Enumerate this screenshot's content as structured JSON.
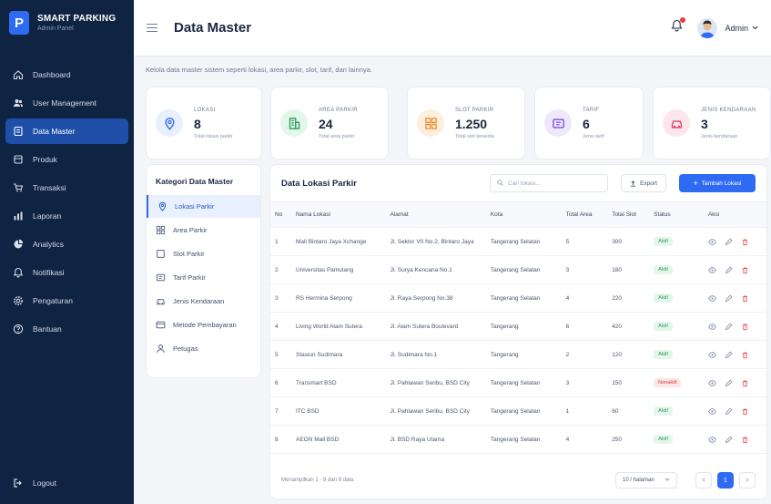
{
  "brand": {
    "logo_letter": "P",
    "title": "SMART PARKING",
    "subtitle": "Admin Panel"
  },
  "sidebar": {
    "items": [
      {
        "label": "Dashboard",
        "icon": "home-icon"
      },
      {
        "label": "User Management",
        "icon": "users-icon"
      },
      {
        "label": "Data Master",
        "icon": "database-icon",
        "active": true
      },
      {
        "label": "Produk",
        "icon": "box-icon"
      },
      {
        "label": "Transaksi",
        "icon": "cart-icon"
      },
      {
        "label": "Laporan",
        "icon": "bar-chart-icon"
      },
      {
        "label": "Analytics",
        "icon": "pie-chart-icon"
      },
      {
        "label": "Notifikasi",
        "icon": "bell-icon"
      },
      {
        "label": "Pengaturan",
        "icon": "gear-icon"
      },
      {
        "label": "Bantuan",
        "icon": "help-icon"
      }
    ],
    "logout_label": "Logout"
  },
  "header": {
    "title": "Data Master",
    "user_name": "Admin"
  },
  "description": "Kelola data master sistem seperti lokasi, area parkir, slot, tarif, dan lainnya.",
  "stats": [
    {
      "label": "LOKASI",
      "value": "8",
      "sub": "Total lokasi parkir",
      "color": "#2f6bf2",
      "bg": "#e8f0fe",
      "icon": "location-icon"
    },
    {
      "label": "AREA PARKIR",
      "value": "24",
      "sub": "Total area parkir",
      "color": "#2c9c5a",
      "bg": "#e3f6ea",
      "icon": "building-icon"
    },
    {
      "label": "SLOT PARKIR",
      "value": "1.250",
      "sub": "Total slot tersedia",
      "color": "#f08a24",
      "bg": "#fdeedd",
      "icon": "grid-icon"
    },
    {
      "label": "TARIF",
      "value": "6",
      "sub": "Jenis tarif",
      "color": "#7a4fe0",
      "bg": "#efe8fc",
      "icon": "ticket-icon"
    },
    {
      "label": "JENIS KENDARAAN",
      "value": "3",
      "sub": "Jenis kendaraan",
      "color": "#e2416b",
      "bg": "#fde7ec",
      "icon": "car-icon"
    }
  ],
  "categories": {
    "title": "Kategori Data Master",
    "items": [
      {
        "label": "Lokasi Parkir",
        "icon": "location-icon",
        "active": true
      },
      {
        "label": "Area Parkir",
        "icon": "grid-icon"
      },
      {
        "label": "Slot Parkir",
        "icon": "square-icon"
      },
      {
        "label": "Tarif Parkir",
        "icon": "ticket-icon"
      },
      {
        "label": "Jenis Kendaraan",
        "icon": "car-icon"
      },
      {
        "label": "Metode Pembayaran",
        "icon": "credit-card-icon"
      },
      {
        "label": "Petugas",
        "icon": "user-icon"
      }
    ]
  },
  "table": {
    "title": "Data Lokasi Parkir",
    "search_placeholder": "Cari lokasi...",
    "export_label": "Export",
    "add_label": "Tambah Lokasi",
    "columns": [
      "No",
      "Nama Lokasi",
      "Alamat",
      "Kota",
      "Total Area",
      "Total Slot",
      "Status",
      "Aksi"
    ],
    "rows": [
      [
        "1",
        "Mall Bintaro Jaya Xchange",
        "Jl. Sektor VII No.2, Bintaro Jaya",
        "Tangerang Selatan",
        "5",
        "300",
        "Aktif"
      ],
      [
        "2",
        "Universitas Pamulang",
        "Jl. Surya Kencana No.1",
        "Tangerang Selatan",
        "3",
        "180",
        "Aktif"
      ],
      [
        "3",
        "RS Hermina Serpong",
        "Jl. Raya Serpong No.38",
        "Tangerang Selatan",
        "4",
        "220",
        "Aktif"
      ],
      [
        "4",
        "Living World Alam Sutera",
        "Jl. Alam Sutera Boulevard",
        "Tangerang",
        "6",
        "420",
        "Aktif"
      ],
      [
        "5",
        "Stasiun Sudimara",
        "Jl. Sudimara No.1",
        "Tangerang",
        "2",
        "120",
        "Aktif"
      ],
      [
        "6",
        "Transmart BSD",
        "Jl. Pahlawan Seribu, BSD City",
        "Tangerang Selatan",
        "3",
        "150",
        "Nonaktif"
      ],
      [
        "7",
        "ITC BSD",
        "Jl. Pahlawan Seribu, BSD City",
        "Tangerang Selatan",
        "1",
        "60",
        "Aktif"
      ],
      [
        "8",
        "AEON Mall BSD",
        "Jl. BSD Raya Utama",
        "Tangerang Selatan",
        "4",
        "250",
        "Aktif"
      ]
    ],
    "footer_info": "Menampilkan 1 - 8 dari 8 data",
    "per_page": "10 / halaman",
    "pages": [
      "<",
      "1",
      ">"
    ],
    "current_page": "1"
  }
}
